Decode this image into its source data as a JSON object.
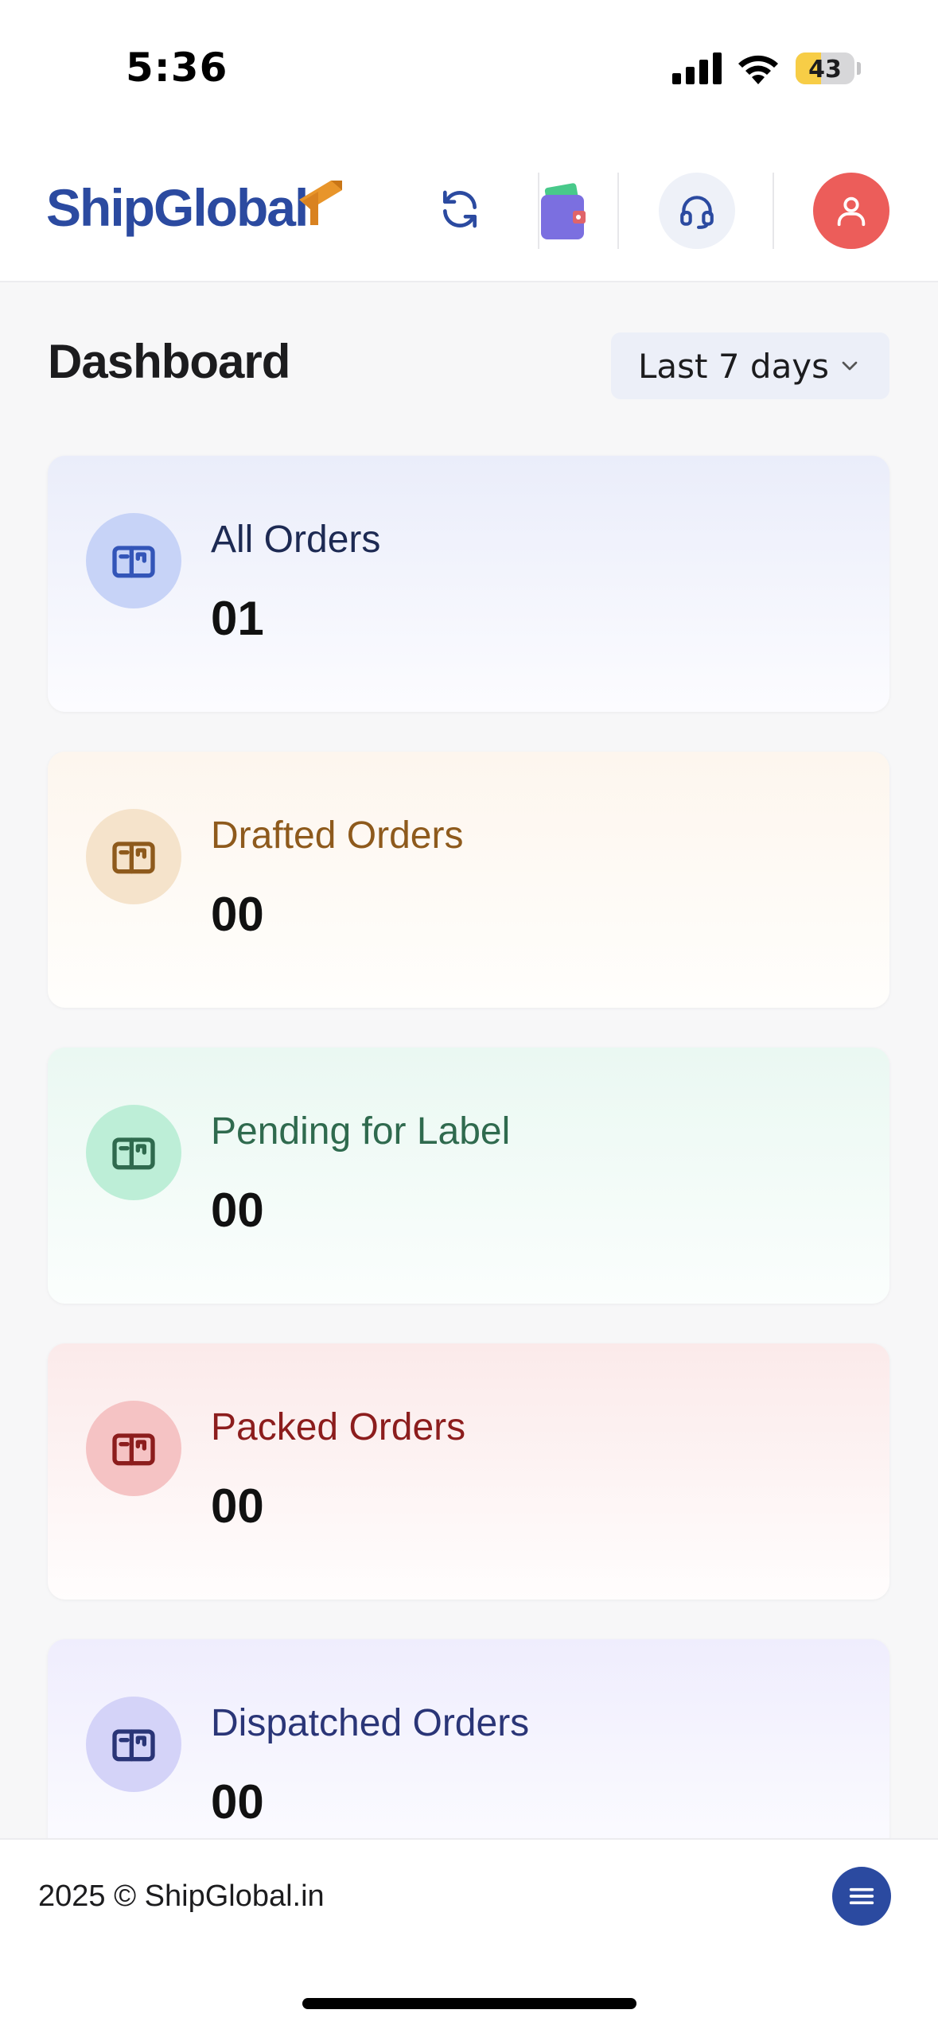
{
  "status_bar": {
    "time": "5:36",
    "battery_level": 43,
    "battery_text": "43"
  },
  "header": {
    "logo_text": "ShipGlobal",
    "brand_color": "#2b4aa0",
    "accent_color": "#e8952a",
    "icons": [
      "refresh-icon",
      "wallet-icon",
      "headset-icon",
      "user-icon"
    ]
  },
  "dashboard": {
    "title": "Dashboard",
    "period": "Last 7 days"
  },
  "cards": [
    {
      "label": "All Orders",
      "value": "01",
      "color": "#3355b8"
    },
    {
      "label": "Drafted Orders",
      "value": "00",
      "color": "#8e5a1c"
    },
    {
      "label": "Pending for Label",
      "value": "00",
      "color": "#2f6a4e"
    },
    {
      "label": "Packed Orders",
      "value": "00",
      "color": "#8c1d1d"
    },
    {
      "label": "Dispatched Orders",
      "value": "00",
      "color": "#2a3577"
    }
  ],
  "footer": {
    "copyright": "2025 © ShipGlobal.in"
  }
}
